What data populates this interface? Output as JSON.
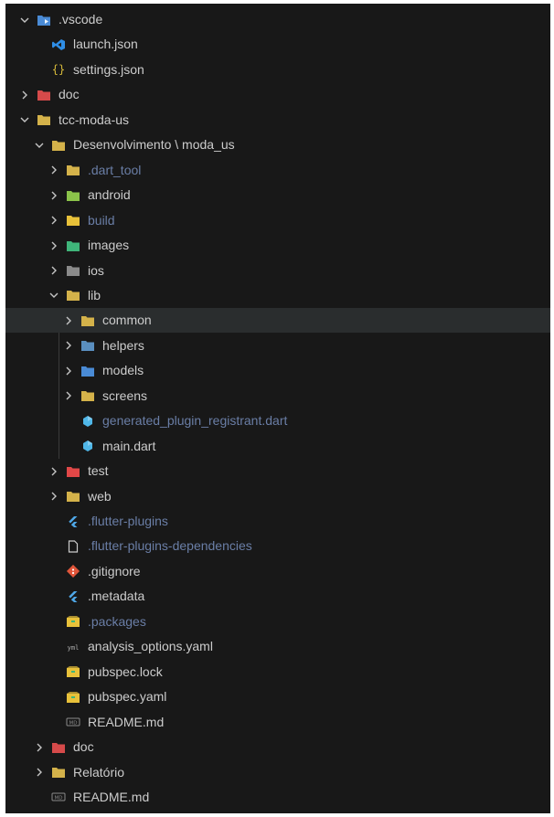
{
  "explorer": {
    "items": [
      {
        "label": ".vscode",
        "depth": 0,
        "type": "folder",
        "expanded": true,
        "icon": "vscode-folder-icon",
        "color": "#4a8bd6"
      },
      {
        "label": "launch.json",
        "depth": 1,
        "type": "file",
        "icon": "vscode-file-icon",
        "color": "#2f8ee6"
      },
      {
        "label": "settings.json",
        "depth": 1,
        "type": "file",
        "icon": "braces-icon",
        "color": "#d7ba3a"
      },
      {
        "label": "doc",
        "depth": 0,
        "type": "folder",
        "expanded": false,
        "icon": "doc-folder-icon",
        "color": "#d64a4a"
      },
      {
        "label": "tcc-moda-us",
        "depth": 0,
        "type": "folder",
        "expanded": true,
        "icon": "folder-icon",
        "color": "#d4b24a"
      },
      {
        "label": "Desenvolvimento \\ moda_us",
        "depth": 1,
        "type": "folder",
        "expanded": true,
        "icon": "folder-icon",
        "color": "#d4b24a"
      },
      {
        "label": ".dart_tool",
        "depth": 2,
        "type": "folder",
        "expanded": false,
        "icon": "folder-icon",
        "color": "#d4b24a",
        "dim": true
      },
      {
        "label": "android",
        "depth": 2,
        "type": "folder",
        "expanded": false,
        "icon": "android-folder-icon",
        "color": "#8bc34a"
      },
      {
        "label": "build",
        "depth": 2,
        "type": "folder",
        "expanded": false,
        "icon": "build-folder-icon",
        "color": "#e8c13a",
        "dim": true
      },
      {
        "label": "images",
        "depth": 2,
        "type": "folder",
        "expanded": false,
        "icon": "images-folder-icon",
        "color": "#3fb57a"
      },
      {
        "label": "ios",
        "depth": 2,
        "type": "folder",
        "expanded": false,
        "icon": "ios-folder-icon",
        "color": "#8a8a8a"
      },
      {
        "label": "lib",
        "depth": 2,
        "type": "folder",
        "expanded": true,
        "icon": "lib-folder-icon",
        "color": "#d4b24a"
      },
      {
        "label": "common",
        "depth": 3,
        "type": "folder",
        "expanded": false,
        "icon": "folder-icon",
        "color": "#d4b24a",
        "selected": true
      },
      {
        "label": "helpers",
        "depth": 3,
        "type": "folder",
        "expanded": false,
        "icon": "helpers-folder-icon",
        "color": "#5a8fbf"
      },
      {
        "label": "models",
        "depth": 3,
        "type": "folder",
        "expanded": false,
        "icon": "models-folder-icon",
        "color": "#4a8bd6"
      },
      {
        "label": "screens",
        "depth": 3,
        "type": "folder",
        "expanded": false,
        "icon": "folder-icon",
        "color": "#d4b24a"
      },
      {
        "label": "generated_plugin_registrant.dart",
        "depth": 3,
        "type": "file",
        "icon": "dart-icon",
        "color": "#4fb7e8",
        "dim": true
      },
      {
        "label": "main.dart",
        "depth": 3,
        "type": "file",
        "icon": "dart-icon",
        "color": "#4fb7e8"
      },
      {
        "label": "test",
        "depth": 2,
        "type": "folder",
        "expanded": false,
        "icon": "test-folder-icon",
        "color": "#e04848"
      },
      {
        "label": "web",
        "depth": 2,
        "type": "folder",
        "expanded": false,
        "icon": "folder-icon",
        "color": "#d4b24a"
      },
      {
        "label": ".flutter-plugins",
        "depth": 2,
        "type": "file",
        "icon": "flutter-icon",
        "color": "#4fa8e8",
        "dim": true
      },
      {
        "label": ".flutter-plugins-dependencies",
        "depth": 2,
        "type": "file",
        "icon": "file-icon",
        "color": "#cccccc",
        "dim": true
      },
      {
        "label": ".gitignore",
        "depth": 2,
        "type": "file",
        "icon": "git-icon",
        "color": "#e0553a"
      },
      {
        "label": ".metadata",
        "depth": 2,
        "type": "file",
        "icon": "flutter-icon",
        "color": "#4fa8e8"
      },
      {
        "label": ".packages",
        "depth": 2,
        "type": "file",
        "icon": "package-icon",
        "color": "#e8c13a",
        "dim": true
      },
      {
        "label": "analysis_options.yaml",
        "depth": 2,
        "type": "file",
        "icon": "yaml-icon",
        "color": "#b0b0b0"
      },
      {
        "label": "pubspec.lock",
        "depth": 2,
        "type": "file",
        "icon": "package-icon",
        "color": "#e8c13a"
      },
      {
        "label": "pubspec.yaml",
        "depth": 2,
        "type": "file",
        "icon": "package-icon",
        "color": "#e8c13a"
      },
      {
        "label": "README.md",
        "depth": 2,
        "type": "file",
        "icon": "markdown-icon",
        "color": "#8a8a8a"
      },
      {
        "label": "doc",
        "depth": 1,
        "type": "folder",
        "expanded": false,
        "icon": "doc-folder-icon",
        "color": "#d64a4a"
      },
      {
        "label": "Relatório",
        "depth": 1,
        "type": "folder",
        "expanded": false,
        "icon": "folder-icon",
        "color": "#d4b24a"
      },
      {
        "label": "README.md",
        "depth": 1,
        "type": "file",
        "icon": "markdown-icon",
        "color": "#8a8a8a"
      }
    ]
  }
}
